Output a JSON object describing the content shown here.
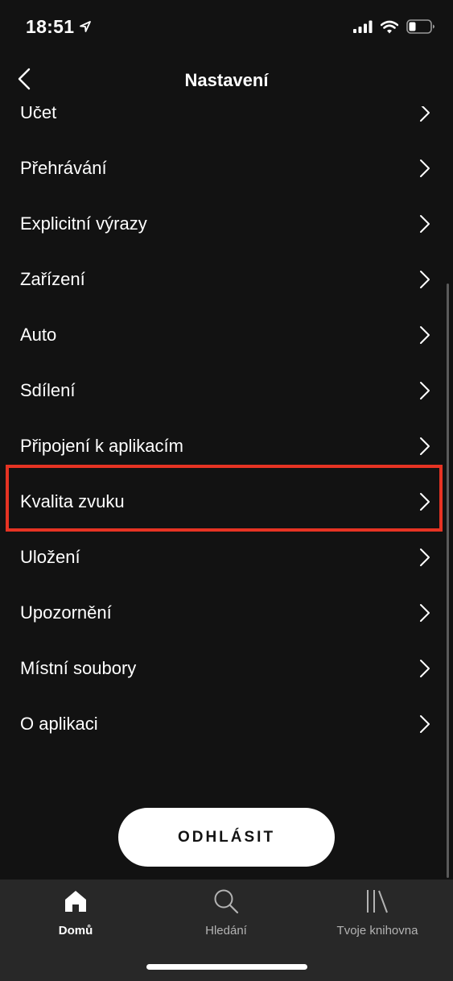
{
  "status_bar": {
    "time": "18:51",
    "location_icon": "location-arrow-icon",
    "signal_icon": "cellular-signal-icon",
    "wifi_icon": "wifi-icon",
    "battery_icon": "battery-icon"
  },
  "header": {
    "title": "Nastavení",
    "back_icon": "chevron-left-icon"
  },
  "settings": {
    "items": [
      {
        "label": "Účet"
      },
      {
        "label": "Přehrávání"
      },
      {
        "label": "Explicitní výrazy"
      },
      {
        "label": "Zařízení"
      },
      {
        "label": "Auto"
      },
      {
        "label": "Sdílení"
      },
      {
        "label": "Připojení k aplikacím"
      },
      {
        "label": "Kvalita zvuku",
        "highlighted": true
      },
      {
        "label": "Uložení"
      },
      {
        "label": "Upozornění"
      },
      {
        "label": "Místní soubory"
      },
      {
        "label": "O aplikaci"
      }
    ],
    "chevron_icon": "chevron-right-icon",
    "highlight_color": "#e63323"
  },
  "logout": {
    "label": "ODHLÁSIT"
  },
  "tab_bar": {
    "tabs": [
      {
        "label": "Domů",
        "icon": "home-icon",
        "active": true
      },
      {
        "label": "Hledání",
        "icon": "search-icon",
        "active": false
      },
      {
        "label": "Tvoje knihovna",
        "icon": "library-icon",
        "active": false
      }
    ]
  },
  "colors": {
    "background": "#121212",
    "tab_bar": "#282828",
    "text_primary": "#ffffff",
    "text_secondary": "#b3b3b3"
  }
}
